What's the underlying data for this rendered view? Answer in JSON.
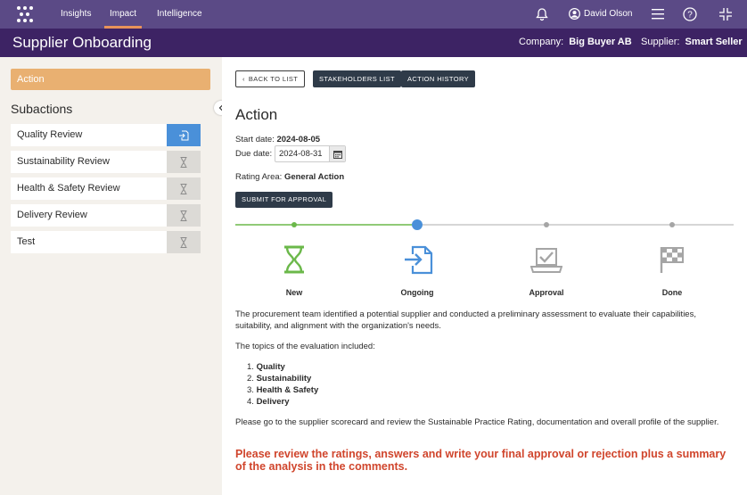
{
  "nav": {
    "links": [
      "Insights",
      "Impact",
      "Intelligence"
    ],
    "active": "Impact",
    "user": "David Olson"
  },
  "titlebar": {
    "title": "Supplier Onboarding",
    "company_label": "Company:",
    "company": "Big Buyer AB",
    "supplier_label": "Supplier:",
    "supplier": "Smart Seller"
  },
  "sidebar": {
    "action_tab": "Action",
    "subactions_title": "Subactions",
    "items": [
      {
        "label": "Quality Review",
        "status": "in-progress-icon"
      },
      {
        "label": "Sustainability Review",
        "status": "hourglass-icon"
      },
      {
        "label": "Health & Safety Review",
        "status": "hourglass-icon"
      },
      {
        "label": "Delivery Review",
        "status": "hourglass-icon"
      },
      {
        "label": "Test",
        "status": "hourglass-icon"
      }
    ]
  },
  "toolbar": {
    "back": "BACK TO LIST",
    "stakeholders": "STAKEHOLDERS LIST",
    "history": "ACTION HISTORY"
  },
  "action": {
    "title": "Action",
    "start_label": "Start date:",
    "start_date": "2024-08-05",
    "due_label": "Due date:",
    "due_date": "2024-08-31",
    "rating_label": "Rating Area:",
    "rating_area": "General Action",
    "submit": "SUBMIT FOR APPROVAL"
  },
  "steps": [
    {
      "label": "New",
      "icon": "hourglass-icon",
      "color": "#6bb84a"
    },
    {
      "label": "Ongoing",
      "icon": "document-arrow-icon",
      "color": "#4a90d9"
    },
    {
      "label": "Approval",
      "icon": "checkbox-tray-icon",
      "color": "#a5a5a5"
    },
    {
      "label": "Done",
      "icon": "flag-icon",
      "color": "#a5a5a5"
    }
  ],
  "content": {
    "p1": "The procurement team identified a potential supplier and conducted a preliminary assessment to evaluate their capabilities, suitability, and alignment with the organization's needs.",
    "p2": "The topics of the evaluation included:",
    "topics": [
      "Quality",
      "Sustainability",
      "Health & Safety",
      "Delivery"
    ],
    "p3": "Please go to the supplier scorecard and review the Sustainable Practice Rating, documentation and overall profile of the supplier.",
    "highlight": "Please review the ratings, answers and write your final approval or rejection plus a summary of the analysis in the comments."
  },
  "colors": {
    "nav": "#5b4a86",
    "titlebar": "#3d2364",
    "accent": "#e8935a",
    "action_tab": "#e9b071",
    "highlight_text": "#d0452c"
  }
}
